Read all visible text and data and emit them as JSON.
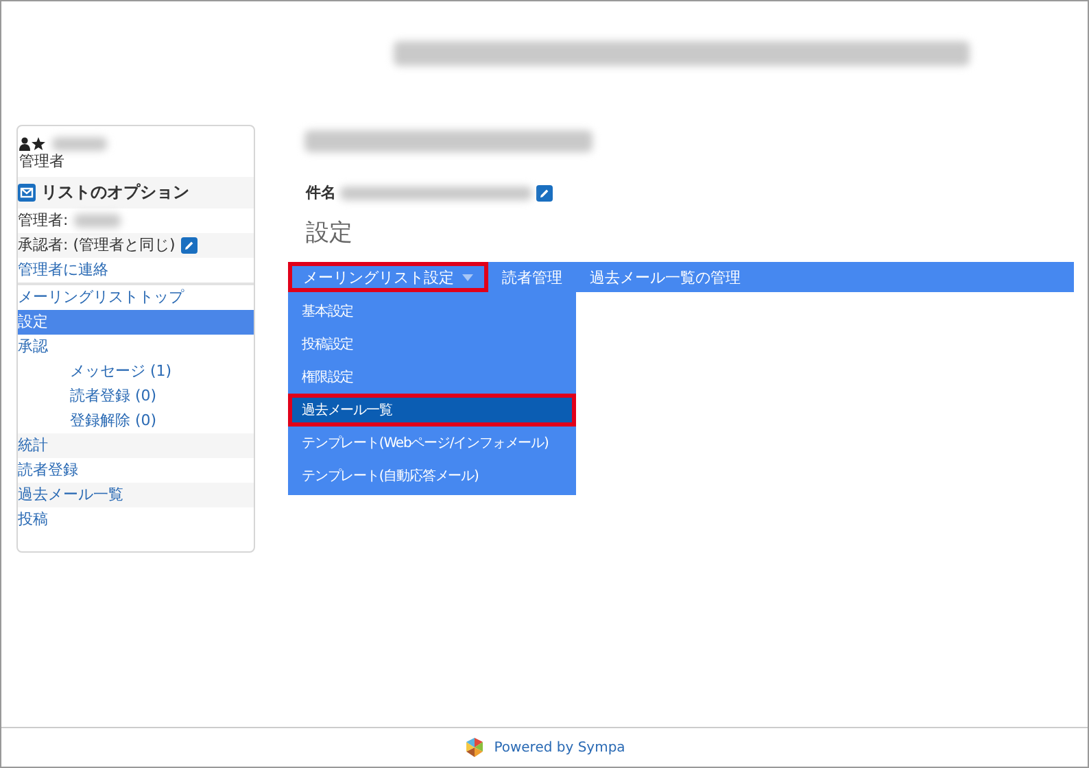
{
  "sidebar": {
    "user_role": "管理者",
    "section_title": "リストのオプション",
    "info": [
      {
        "label": "管理者:",
        "kind": "redacted"
      },
      {
        "label": "承認者: (管理者と同じ)",
        "kind": "editable"
      }
    ],
    "items": [
      {
        "label": "管理者に連絡",
        "selected": false
      },
      {
        "label": "メーリングリストトップ",
        "selected": false
      },
      {
        "label": "設定",
        "selected": true
      },
      {
        "label": "承認",
        "selected": false,
        "children": [
          {
            "label": "メッセージ (1)",
            "selected": false
          },
          {
            "label": "読者登録 (0)",
            "selected": false
          },
          {
            "label": "登録解除 (0)",
            "selected": false
          }
        ]
      },
      {
        "label": "統計",
        "selected": false
      },
      {
        "label": "読者登録",
        "selected": false
      },
      {
        "label": "過去メール一覧",
        "selected": false
      },
      {
        "label": "投稿",
        "selected": false
      }
    ]
  },
  "main": {
    "subject_label": "件名",
    "section_title": "設定",
    "menu": [
      {
        "label": "メーリングリスト設定",
        "kind": "dropdown",
        "expanded": true,
        "highlighted": true,
        "items": [
          {
            "label": "基本設定",
            "selected": false,
            "highlighted": false
          },
          {
            "label": "投稿設定",
            "selected": false,
            "highlighted": false
          },
          {
            "label": "権限設定",
            "selected": false,
            "highlighted": false
          },
          {
            "label": "過去メール一覧",
            "selected": true,
            "highlighted": true
          },
          {
            "label": "テンプレート(Webページ/インフォメール)",
            "selected": false,
            "highlighted": false
          },
          {
            "label": "テンプレート(自動応答メール)",
            "selected": false,
            "highlighted": false
          }
        ]
      },
      {
        "label": "読者管理",
        "kind": "link",
        "highlighted": false
      },
      {
        "label": "過去メール一覧の管理",
        "kind": "link",
        "highlighted": false
      }
    ]
  },
  "footer": {
    "text": "Powered by Sympa"
  }
}
